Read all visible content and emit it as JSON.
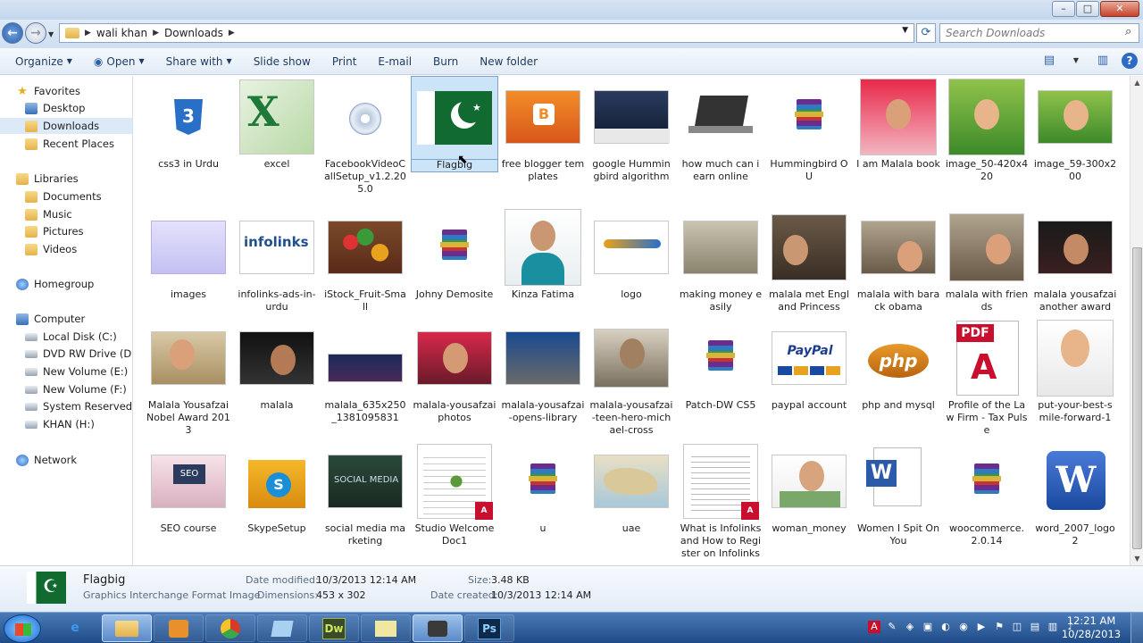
{
  "window": {
    "min_btn": "–",
    "max_btn": "□",
    "close_btn": "✕"
  },
  "address": {
    "path": [
      "wali khan",
      "Downloads"
    ],
    "search_placeholder": "Search Downloads"
  },
  "toolbar": {
    "organize": "Organize",
    "open": "Open",
    "share_with": "Share with",
    "slide_show": "Slide show",
    "print": "Print",
    "email": "E-mail",
    "burn": "Burn",
    "new_folder": "New folder"
  },
  "nav": {
    "favorites": "Favorites",
    "desktop": "Desktop",
    "downloads": "Downloads",
    "recent": "Recent Places",
    "libraries": "Libraries",
    "documents": "Documents",
    "music": "Music",
    "pictures": "Pictures",
    "videos": "Videos",
    "homegroup": "Homegroup",
    "computer": "Computer",
    "drive_c": "Local Disk (C:)",
    "drive_d": "DVD RW Drive (D:)",
    "drive_e": "New Volume (E:)",
    "drive_f": "New Volume (F:)",
    "drive_g": "System Reserved (G:",
    "drive_h": "KHAN (H:)",
    "network": "Network"
  },
  "files": [
    "css3 in Urdu",
    "excel",
    "FacebookVideoCallSetup_v1.2.205.0",
    "Flagbig",
    "free blogger templates",
    "google Hummingbird algorithm",
    "how much can i earn online",
    "Hummingbird OU",
    "I am Malala book",
    "image_50-420x420",
    "image_59-300x200",
    "images",
    "infolinks-ads-in-urdu",
    "iStock_Fruit-Small",
    "Johny Demosite",
    "Kinza Fatima",
    "logo",
    "making money easily",
    "malala met England Princess",
    "malala with barack obama",
    "malala with friends",
    "malala yousafzai another award",
    "Malala Yousafzai Nobel Award 2013",
    "malala",
    "malala_635x250_1381095831",
    "malala-yousafzai photos",
    "malala-yousafzai-opens-library",
    "malala-yousafzai-teen-hero-michael-cross",
    "Patch-DW CS5",
    "paypal account",
    "php and mysql",
    "Profile of the Law Firm - Tax Pulse",
    "put-your-best-smile-forward-1",
    "SEO course",
    "SkypeSetup",
    "social media marketing",
    "Studio Welcome Doc1",
    "u",
    "uae",
    "What is Infolinks and How to Register on Infolinks",
    "woman_money",
    "Women I Spit On You",
    "woocommerce.2.0.14",
    "word_2007_logo2"
  ],
  "thumb_text": {
    "css3": "3",
    "excel": "X",
    "blogger": "B",
    "infolinks": "infolinks",
    "paypal": "PayPal",
    "php": "php",
    "pdf": "PDF",
    "pdf_a": "A",
    "seo": "SEO",
    "skype": "S",
    "social": "SOCIAL MEDIA",
    "word": "W",
    "pdf_badge": "A"
  },
  "details": {
    "name": "Flagbig",
    "type": "Graphics Interchange Format Image",
    "date_modified_label": "Date modified:",
    "date_modified": "10/3/2013 12:14 AM",
    "dimensions_label": "Dimensions:",
    "dimensions": "453 x 302",
    "size_label": "Size:",
    "size": "3.48 KB",
    "date_created_label": "Date created:",
    "date_created": "10/3/2013 12:14 AM"
  },
  "taskbar": {
    "apps": [
      "",
      "e",
      "",
      "",
      "",
      "",
      "Dw",
      "",
      "",
      "Ps"
    ],
    "time": "12:21 AM",
    "date": "10/28/2013"
  }
}
